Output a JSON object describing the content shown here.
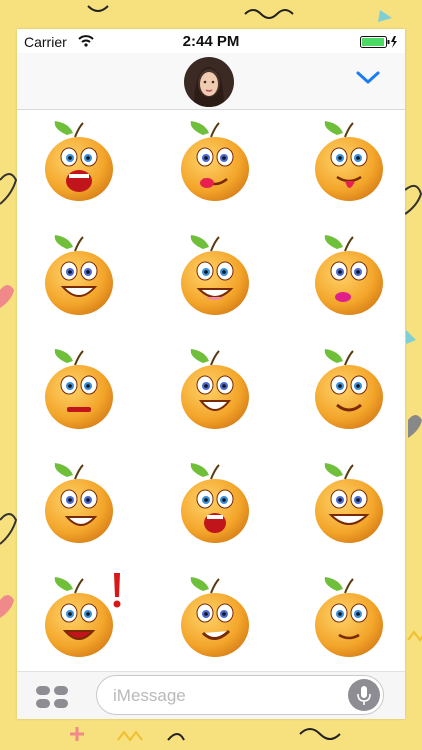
{
  "status": {
    "carrier": "Carrier",
    "time": "2:44 PM"
  },
  "header": {
    "avatar_name": "contact-avatar",
    "collapse_icon": "chevron-down-icon"
  },
  "stickers": [
    {
      "name": "orange-scared-screaming"
    },
    {
      "name": "orange-bow-lipstick"
    },
    {
      "name": "orange-tongue-out"
    },
    {
      "name": "orange-thumbs-up-grin"
    },
    {
      "name": "orange-big-smile-teeth"
    },
    {
      "name": "orange-kiss-lips"
    },
    {
      "name": "orange-crying-worried"
    },
    {
      "name": "orange-happy-laughing"
    },
    {
      "name": "orange-smiling-cheeks"
    },
    {
      "name": "orange-waving-hello"
    },
    {
      "name": "orange-angry-shouting"
    },
    {
      "name": "orange-winking-grin"
    },
    {
      "name": "orange-surprised-exclamation"
    },
    {
      "name": "orange-sly-smirk"
    },
    {
      "name": "orange-shy-smile"
    }
  ],
  "message": {
    "placeholder": "iMessage"
  },
  "colors": {
    "background": "#f7e07e",
    "accent": "#1a7cf5",
    "orange": "#f3a52a",
    "leaf": "#6fbf3b"
  }
}
